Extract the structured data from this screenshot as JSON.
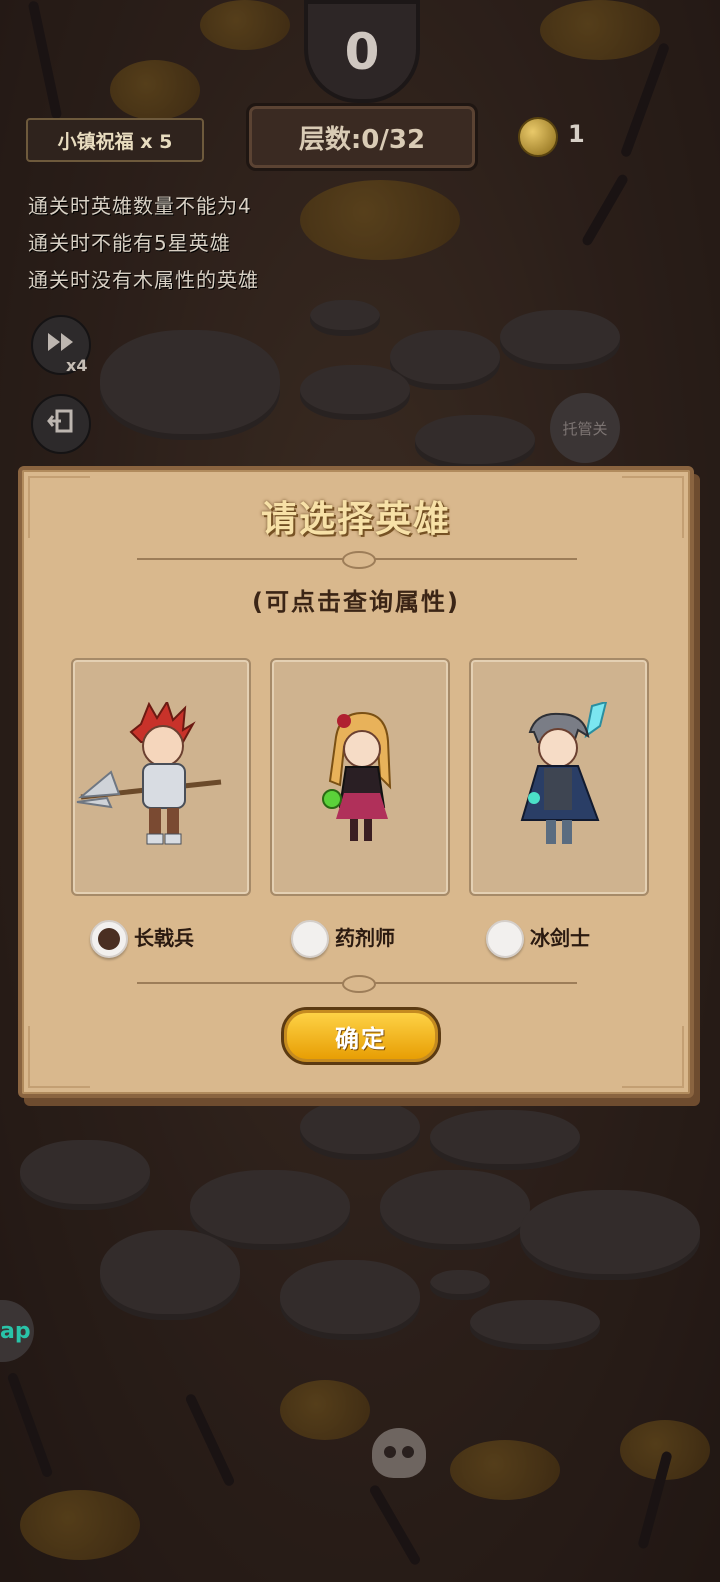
{
  "hud": {
    "score": "0",
    "layer": "层数:0/32",
    "blessing": "小镇祝福 x 5",
    "coins": "1",
    "speed": "x4",
    "auto_label": "托管关"
  },
  "rules": [
    "通关时英雄数量不能为4",
    "通关时不能有5星英雄",
    "通关时没有木属性的英雄"
  ],
  "dialog": {
    "title": "请选择英雄",
    "subtitle": "(可点击查询属性)",
    "options": [
      {
        "label": "长戟兵",
        "selected": true
      },
      {
        "label": "药剂师",
        "selected": false
      },
      {
        "label": "冰剑士",
        "selected": false
      }
    ],
    "confirm": "确定"
  },
  "side_tab": "ap",
  "colors": {
    "panel": "#d9b88d",
    "confirm": "#f5b818",
    "title": "#f7e1a7"
  },
  "icons": [
    "fast-forward-icon",
    "exit-icon",
    "coin-icon",
    "skull-icon"
  ]
}
